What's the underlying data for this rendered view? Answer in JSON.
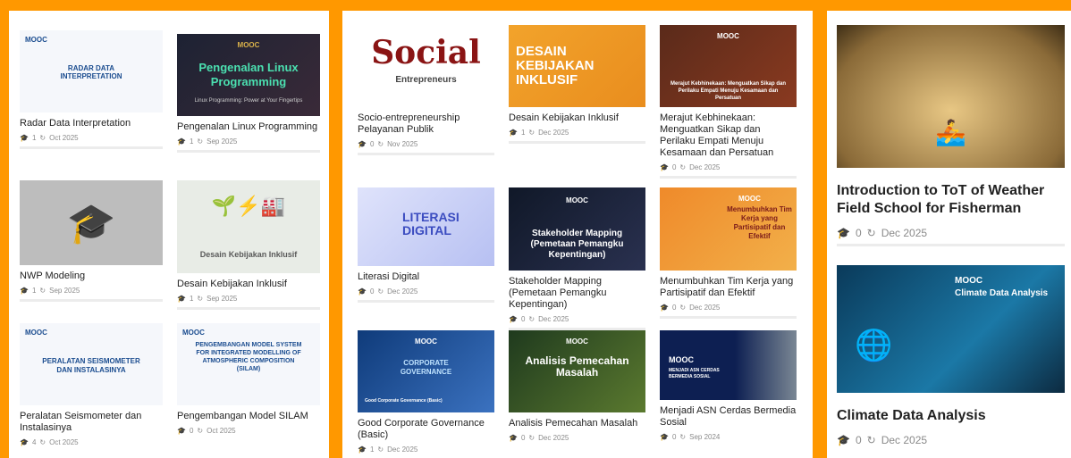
{
  "meta_icons": {
    "enroll": "graduation-cap-icon",
    "date": "refresh-icon"
  },
  "columns": [
    {
      "cards": [
        {
          "title": "Radar Data Interpretation",
          "count": "1",
          "date": "Oct 2025",
          "thumb_tag": "MOOC",
          "thumb_text": "RADAR DATA INTERPRETATION"
        },
        {
          "title": "Pengenalan Linux Programming",
          "count": "1",
          "date": "Sep 2025",
          "thumb_tag": "MOOC",
          "thumb_text": "Pengenalan Linux Programming",
          "thumb_sub": "Linux Programming: Power at Your Fingertips"
        },
        {
          "title": "NWP Modeling",
          "count": "1",
          "date": "Sep 2025"
        },
        {
          "title": "Desain Kebijakan Inklusif",
          "count": "1",
          "date": "Sep 2025",
          "thumb_text": "Desain Kebijakan Inklusif"
        },
        {
          "title": "Peralatan Seismometer dan Instalasinya",
          "count": "4",
          "date": "Oct 2025",
          "thumb_tag": "MOOC",
          "thumb_text": "PERALATAN SEISMOMETER DAN INSTALASINYA"
        },
        {
          "title": "Pengembangan Model SILAM",
          "count": "0",
          "date": "Oct 2025",
          "thumb_tag": "MOOC",
          "thumb_text": "PENGEMBANGAN MODEL SYSTEM FOR INTEGRATED MODELLING OF ATMOSPHERIC COMPOSITION (SILAM)"
        }
      ]
    },
    {
      "cards": [
        {
          "title": "Socio-entrepreneurship Pelayanan Publik",
          "count": "0",
          "date": "Nov 2025",
          "thumb_text": "Social",
          "thumb_sub": "Entrepreneurs"
        },
        {
          "title": "Desain Kebijakan Inklusif",
          "count": "1",
          "date": "Dec 2025",
          "thumb_text": "DESAIN KEBIJAKAN INKLUSIF"
        },
        {
          "title": "Merajut Kebhinekaan: Menguatkan Sikap dan Perilaku Empati Menuju Kesamaan dan Persatuan",
          "count": "0",
          "date": "Dec 2025",
          "thumb_tag": "MOOC",
          "thumb_text": "Merajut Kebhinekaan: Menguatkan Sikap dan Perilaku Empati Menuju Kesamaan dan Persatuan"
        },
        {
          "title": "Literasi Digital",
          "count": "0",
          "date": "Dec 2025",
          "thumb_text": "LITERASI DIGITAL"
        },
        {
          "title": "Stakeholder Mapping (Pemetaan Pemangku Kepentingan)",
          "count": "0",
          "date": "Dec 2025",
          "thumb_tag": "MOOC",
          "thumb_text": "Stakeholder Mapping (Pemetaan Pemangku Kepentingan)"
        },
        {
          "title": "Menumbuhkan Tim Kerja yang Partisipatif dan Efektif",
          "count": "0",
          "date": "Dec 2025",
          "thumb_tag": "MOOC",
          "thumb_text": "Menumbuhkan Tim Kerja yang Partisipatif dan Efektif"
        },
        {
          "title": "Good Corporate Governance (Basic)",
          "count": "1",
          "date": "Dec 2025",
          "thumb_tag": "MOOC",
          "thumb_text": "CORPORATE GOVERNANCE",
          "thumb_sub": "Good Corporate Governance (Basic)"
        },
        {
          "title": "Analisis Pemecahan Masalah",
          "count": "0",
          "date": "Dec 2025",
          "thumb_tag": "MOOC",
          "thumb_text": "Analisis Pemecahan Masalah"
        },
        {
          "title": "Menjadi ASN Cerdas Bermedia Sosial",
          "count": "0",
          "date": "Sep 2024",
          "thumb_tag": "MOOC",
          "thumb_text": "MENJADI ASN CERDAS BERMEDIA SOSIAL"
        }
      ]
    },
    {
      "cards": [
        {
          "title": "Introduction to ToT of Weather Field School for Fisherman",
          "count": "0",
          "date": "Dec 2025"
        },
        {
          "title": "Climate Data Analysis",
          "count": "0",
          "date": "Dec 2025",
          "thumb_tag": "MOOC",
          "thumb_text": "Climate Data Analysis"
        }
      ]
    }
  ]
}
